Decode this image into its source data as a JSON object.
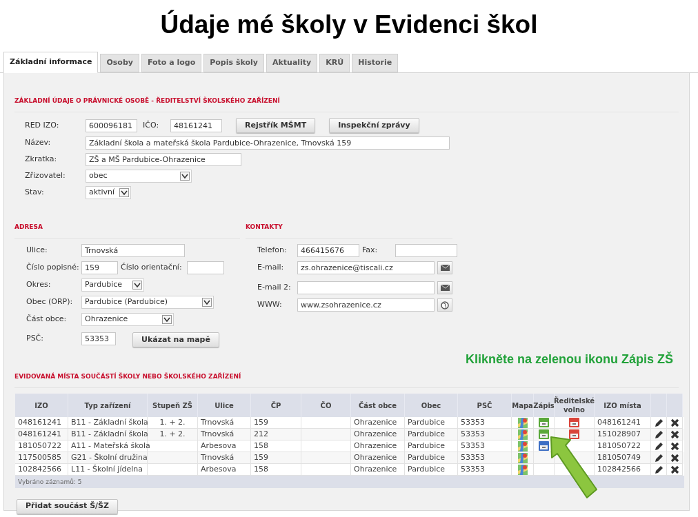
{
  "slide_title": "Údaje mé školy v Evidenci škol",
  "tabs": [
    {
      "label": "Základní informace",
      "selected": true
    },
    {
      "label": "Osoby",
      "selected": false
    },
    {
      "label": "Foto a logo",
      "selected": false
    },
    {
      "label": "Popis školy",
      "selected": false
    },
    {
      "label": "Aktuality",
      "selected": false
    },
    {
      "label": "KRÚ",
      "selected": false
    },
    {
      "label": "Historie",
      "selected": false
    }
  ],
  "legal_entity": {
    "heading": "ZÁKLADNÍ ÚDAJE O PRÁVNICKÉ OSOBĚ - ŘEDITELSTVÍ ŠKOLSKÉHO ZAŘÍZENÍ",
    "red_izo": {
      "label": "RED IZO:",
      "value": "600096181"
    },
    "ico": {
      "label": "IČO:",
      "value": "48161241"
    },
    "buttons": [
      "Rejstřík MŠMT",
      "Inspekční zprávy"
    ],
    "name": {
      "label": "Název:",
      "value": "Základní škola a mateřská škola Pardubice-Ohrazenice, Trnovská 159"
    },
    "short_name": {
      "label": "Zkratka:",
      "value": "ZŠ a MŠ Pardubice-Ohrazenice"
    },
    "founder": {
      "label": "Zřizovatel:",
      "value": "obec"
    },
    "status": {
      "label": "Stav:",
      "value": "aktivní"
    }
  },
  "address": {
    "heading": "ADRESA",
    "street": {
      "label": "Ulice:",
      "value": "Trnovská"
    },
    "house_number": {
      "label": "Číslo popisné:",
      "value": "159"
    },
    "orientation_number": {
      "label": "Číslo orientační:"
    },
    "district": {
      "label": "Okres:",
      "value": "Pardubice"
    },
    "municipality": {
      "label": "Obec (ORP):",
      "value": "Pardubice (Pardubice)"
    },
    "part": {
      "label": "Část obce:",
      "value": "Ohrazenice"
    },
    "zip": {
      "label": "PSČ:",
      "value": "53353"
    },
    "map_button": "Ukázat na mapě"
  },
  "contacts": {
    "heading": "KONTAKTY",
    "phone": {
      "label": "Telefon:",
      "value": "466415676"
    },
    "fax": {
      "label": "Fax:"
    },
    "email": {
      "label": "E-mail:",
      "value": "zs.ohrazenice@tiscali.cz"
    },
    "email2": {
      "label": "E-mail 2:"
    },
    "www": {
      "label": "WWW:",
      "value": "www.zsohrazenice.cz"
    }
  },
  "hint": "Klikněte na zelenou ikonu Zápis ZŠ",
  "places": {
    "heading": "EVIDOVANÁ MÍSTA SOUČÁSTÍ ŠKOLY NEBO ŠKOLSKÉHO ZAŘÍZENÍ",
    "columns": [
      "IZO",
      "Typ zařízení",
      "Stupeň ZŠ",
      "Ulice",
      "ČP",
      "ČO",
      "Část obce",
      "Obec",
      "PSČ",
      "Mapa",
      "Zápis",
      "Ředitelské volno",
      "IZO místa"
    ],
    "rows": [
      {
        "izo": "048161241",
        "type": "B11 - Základní škola",
        "grade": "1. + 2.",
        "street": "Trnovská",
        "cp": "159",
        "part": "Ohrazenice",
        "town": "Pardubice",
        "zip": "53353",
        "enrolment": {
          "color": "#5aa83a"
        },
        "day_off": true,
        "place_izo": "048161241"
      },
      {
        "izo": "048161241",
        "type": "B11 - Základní škola",
        "grade": "1. + 2.",
        "street": "Trnovská",
        "cp": "212",
        "part": "Ohrazenice",
        "town": "Pardubice",
        "zip": "53353",
        "enrolment": {
          "color": "#5aa83a"
        },
        "day_off": true,
        "place_izo": "151028907"
      },
      {
        "izo": "181050722",
        "type": "A11 - Mateřská škola",
        "street": "Arbesova",
        "cp": "158",
        "part": "Ohrazenice",
        "town": "Pardubice",
        "zip": "53353",
        "enrolment": {
          "color": "#3d6fc4"
        },
        "place_izo": "181050722"
      },
      {
        "izo": "117500585",
        "type": "G21 - Školní družina",
        "street": "Trnovská",
        "cp": "159",
        "part": "Ohrazenice",
        "town": "Pardubice",
        "zip": "53353",
        "place_izo": "181050749"
      },
      {
        "izo": "102842566",
        "type": "L11 - Školní jídelna",
        "street": "Arbesova",
        "cp": "158",
        "part": "Ohrazenice",
        "town": "Pardubice",
        "zip": "53353",
        "place_izo": "102842566"
      }
    ],
    "footer": "Vybráno záznamů: 5",
    "add_button": "Přidat součást Š/ŠZ"
  }
}
